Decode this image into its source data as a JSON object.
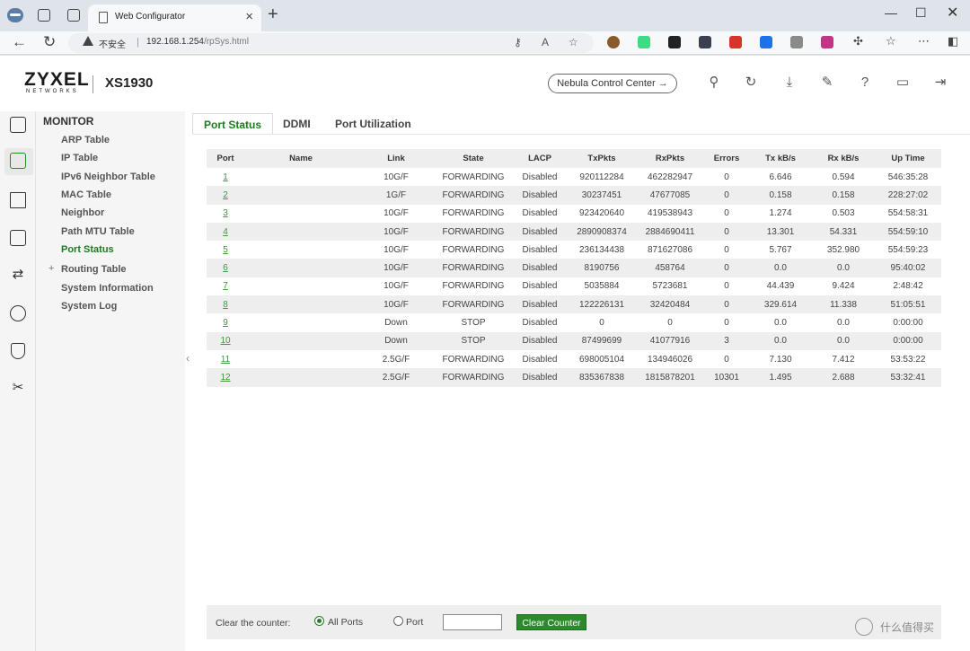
{
  "browser": {
    "tab_title": "Web Configurator",
    "security_label": "不安全",
    "url_host": "192.168.1.254",
    "url_path": "/rpSys.html"
  },
  "header": {
    "brand": "ZYXEL",
    "brand_sub": "NETWORKS",
    "model": "XS1930",
    "nebula_label": "Nebula Control Center →"
  },
  "menu": {
    "heading": "MONITOR",
    "items": [
      {
        "label": "ARP Table",
        "active": false
      },
      {
        "label": "IP Table",
        "active": false
      },
      {
        "label": "IPv6 Neighbor Table",
        "active": false
      },
      {
        "label": "MAC Table",
        "active": false
      },
      {
        "label": "Neighbor",
        "active": false
      },
      {
        "label": "Path MTU Table",
        "active": false
      },
      {
        "label": "Port Status",
        "active": true
      },
      {
        "label": "Routing Table",
        "active": false
      },
      {
        "label": "System Information",
        "active": false
      },
      {
        "label": "System Log",
        "active": false
      }
    ]
  },
  "tabs": [
    "Port Status",
    "DDMI",
    "Port Utilization"
  ],
  "table": {
    "columns": [
      "Port",
      "Name",
      "Link",
      "State",
      "LACP",
      "TxPkts",
      "RxPkts",
      "Errors",
      "Tx kB/s",
      "Rx kB/s",
      "Up Time"
    ],
    "rows": [
      [
        "1",
        "",
        "10G/F",
        "FORWARDING",
        "Disabled",
        "920112284",
        "462282947",
        "0",
        "6.646",
        "0.594",
        "546:35:28"
      ],
      [
        "2",
        "",
        "1G/F",
        "FORWARDING",
        "Disabled",
        "30237451",
        "47677085",
        "0",
        "0.158",
        "0.158",
        "228:27:02"
      ],
      [
        "3",
        "",
        "10G/F",
        "FORWARDING",
        "Disabled",
        "923420640",
        "419538943",
        "0",
        "1.274",
        "0.503",
        "554:58:31"
      ],
      [
        "4",
        "",
        "10G/F",
        "FORWARDING",
        "Disabled",
        "2890908374",
        "2884690411",
        "0",
        "13.301",
        "54.331",
        "554:59:10"
      ],
      [
        "5",
        "",
        "10G/F",
        "FORWARDING",
        "Disabled",
        "236134438",
        "871627086",
        "0",
        "5.767",
        "352.980",
        "554:59:23"
      ],
      [
        "6",
        "",
        "10G/F",
        "FORWARDING",
        "Disabled",
        "8190756",
        "458764",
        "0",
        "0.0",
        "0.0",
        "95:40:02"
      ],
      [
        "7",
        "",
        "10G/F",
        "FORWARDING",
        "Disabled",
        "5035884",
        "5723681",
        "0",
        "44.439",
        "9.424",
        "2:48:42"
      ],
      [
        "8",
        "",
        "10G/F",
        "FORWARDING",
        "Disabled",
        "122226131",
        "32420484",
        "0",
        "329.614",
        "11.338",
        "51:05:51"
      ],
      [
        "9",
        "",
        "Down",
        "STOP",
        "Disabled",
        "0",
        "0",
        "0",
        "0.0",
        "0.0",
        "0:00:00"
      ],
      [
        "10",
        "",
        "Down",
        "STOP",
        "Disabled",
        "87499699",
        "41077916",
        "3",
        "0.0",
        "0.0",
        "0:00:00"
      ],
      [
        "11",
        "",
        "2.5G/F",
        "FORWARDING",
        "Disabled",
        "698005104",
        "134946026",
        "0",
        "7.130",
        "7.412",
        "53:53:22"
      ],
      [
        "12",
        "",
        "2.5G/F",
        "FORWARDING",
        "Disabled",
        "835367838",
        "1815878201",
        "10301",
        "1.495",
        "2.688",
        "53:32:41"
      ]
    ]
  },
  "clear": {
    "label": "Clear the counter:",
    "all_ports": "All Ports",
    "port": "Port",
    "port_value": "",
    "button": "Clear Counter"
  },
  "watermark": "什么值得买"
}
